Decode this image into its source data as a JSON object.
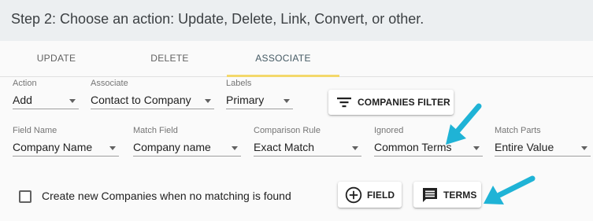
{
  "header": {
    "title": "Step 2: Choose an action: Update, Delete, Link, Convert, or other."
  },
  "tabs": [
    {
      "label": "UPDATE",
      "active": false
    },
    {
      "label": "DELETE",
      "active": false
    },
    {
      "label": "ASSOCIATE",
      "active": true
    }
  ],
  "row1": {
    "action": {
      "label": "Action",
      "value": "Add"
    },
    "associate": {
      "label": "Associate",
      "value": "Contact to Company"
    },
    "labels": {
      "label": "Labels",
      "value": "Primary"
    },
    "companies_filter_button": {
      "label": "COMPANIES FILTER",
      "icon": "filter-list-icon"
    }
  },
  "row2": {
    "field_name": {
      "label": "Field Name",
      "value": "Company Name"
    },
    "match_field": {
      "label": "Match Field",
      "value": "Company name"
    },
    "comparison_rule": {
      "label": "Comparison Rule",
      "value": "Exact Match"
    },
    "ignored": {
      "label": "Ignored",
      "value": "Common Terms"
    },
    "match_parts": {
      "label": "Match Parts",
      "value": "Entire Value"
    }
  },
  "row3": {
    "create_companies": {
      "label": "Create new Companies when no matching is found",
      "checked": false
    },
    "field_button": {
      "label": "FIELD",
      "icon": "add-circle-icon"
    },
    "terms_button": {
      "label": "TERMS",
      "icon": "comment-icon"
    }
  },
  "colors": {
    "header_bg": "#eceff1",
    "tab_indicator": "#f3d86b",
    "annotation_arrow": "#1fb3d6"
  }
}
